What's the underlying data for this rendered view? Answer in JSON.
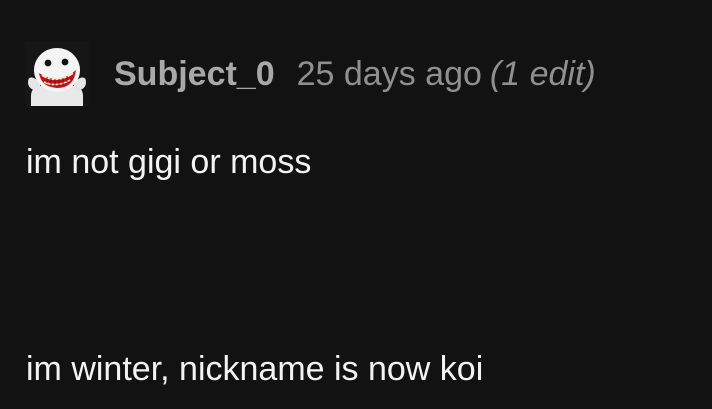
{
  "comment": {
    "author": {
      "username": "Subject_0",
      "avatar_icon": "grinning-ghost-avatar-icon"
    },
    "timestamp": "25 days ago",
    "edit_note": "(1 edit)",
    "body_lines": [
      "im not gigi or moss",
      "im winter, nickname is now koi"
    ]
  },
  "colors": {
    "background": "#121212",
    "username": "#a8a8a8",
    "meta": "#8f8f8f",
    "body_text": "#f3f3f3"
  }
}
